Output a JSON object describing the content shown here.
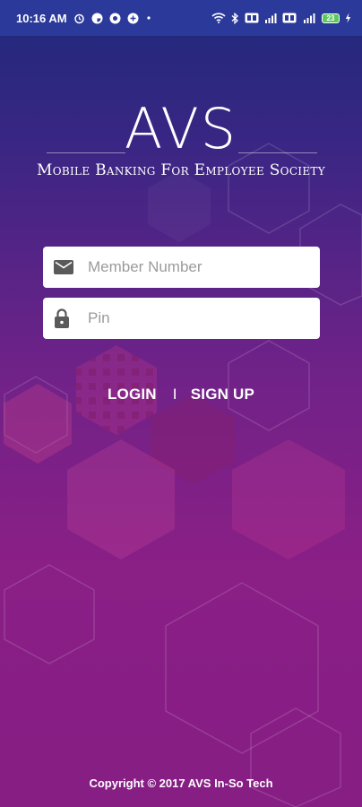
{
  "status_bar": {
    "time": "10:16 AM",
    "left_icons": [
      "alarm-icon",
      "notification-icon",
      "app-icon",
      "app-icon-2",
      "dot-icon"
    ],
    "right_icons": [
      "wifi-icon",
      "bluetooth-icon",
      "hd-icon",
      "signal-icon",
      "hd-icon-2",
      "signal-4g-icon"
    ],
    "battery": "23"
  },
  "brand": {
    "title": "AVS",
    "subtitle": "Mobile Banking For Employee Society"
  },
  "form": {
    "member_placeholder": "Member Number",
    "pin_placeholder": "Pin"
  },
  "actions": {
    "login": "LOGIN",
    "separator": "I",
    "signup": "SIGN UP"
  },
  "footer": {
    "copyright": "Copyright © 2017 AVS In-So Tech"
  },
  "colors": {
    "status_bar": "#2b3a9a",
    "gradient_top": "#1e2a7a",
    "gradient_bottom": "#861e84"
  }
}
